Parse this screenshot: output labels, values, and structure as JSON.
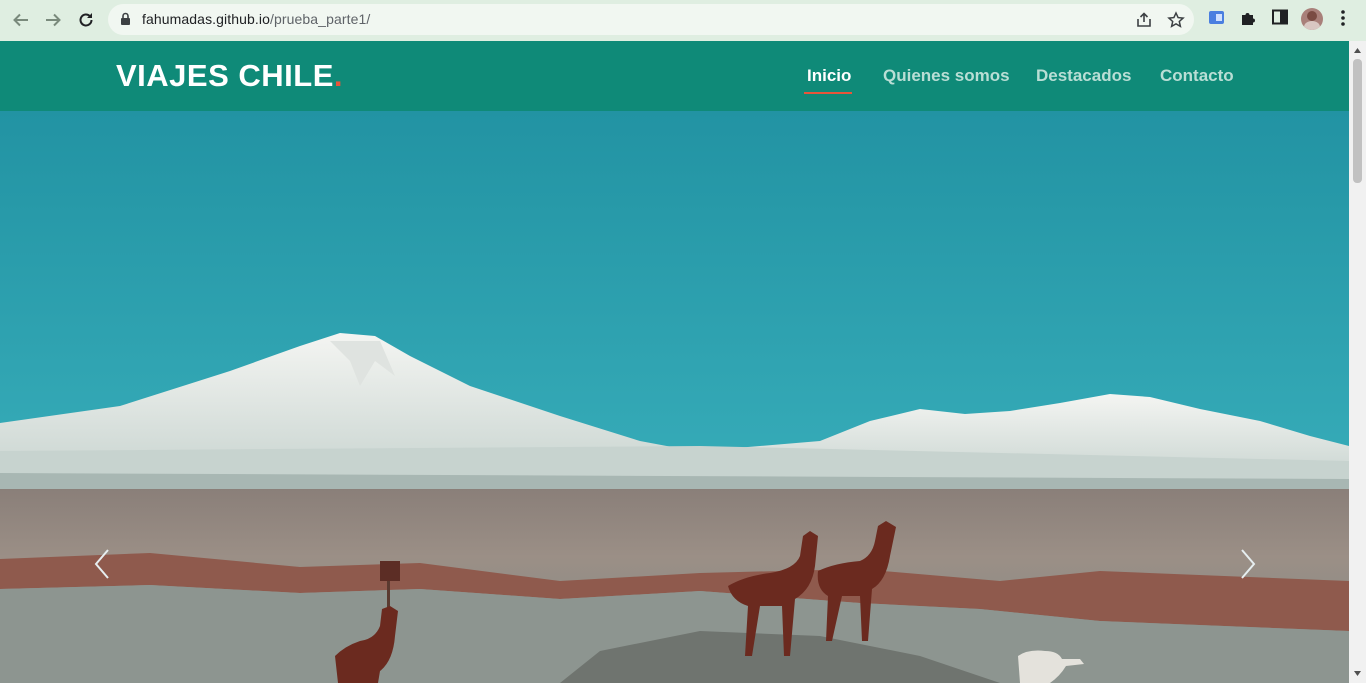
{
  "browser": {
    "url_host": "fahumadas.github.io",
    "url_path": "/prueba_parte1/"
  },
  "site": {
    "logo_text": "VIAJES CHILE",
    "logo_dot": ".",
    "nav": [
      {
        "label": "Inicio",
        "active": true
      },
      {
        "label": "Quienes somos",
        "active": false
      },
      {
        "label": "Destacados",
        "active": false
      },
      {
        "label": "Contacto",
        "active": false
      }
    ]
  },
  "colors": {
    "header": "#0f8a78",
    "accent": "#e8553a",
    "sky": "#2aa0ad"
  },
  "hero": {
    "icons": [
      "chevron-left-icon",
      "chevron-right-icon"
    ]
  }
}
